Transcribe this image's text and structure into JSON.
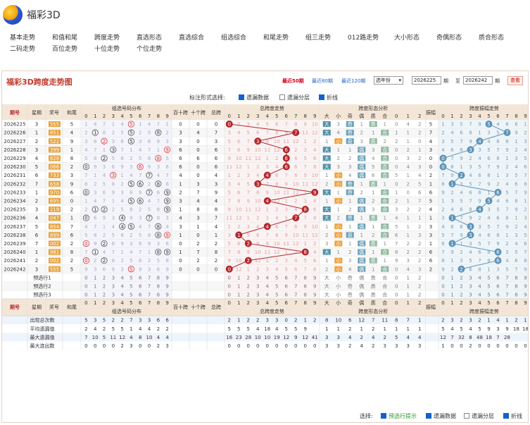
{
  "app": {
    "title": "福彩3D"
  },
  "nav": [
    "基本走势",
    "和值和尾",
    "跨度走势",
    "直选形态",
    "直选综合",
    "组选综合",
    "和尾走势",
    "组三走势",
    "012路走势",
    "大小形态",
    "奇偶形态",
    "质合形态",
    "二码走势",
    "百位走势",
    "十位走势",
    "个位走势"
  ],
  "panel": {
    "title": "福彩3D跨度走势图",
    "links": [
      "最近50期",
      "最近80期",
      "最近120期"
    ],
    "year_select": "选年份",
    "from_issue": "2026225",
    "to_sep": "至",
    "to_issue": "2026242",
    "issue_unit": "期",
    "query_button": "查看"
  },
  "display_options": {
    "label": "标注形式选择:",
    "items": [
      {
        "label": "遗漏数据",
        "checked": true
      },
      {
        "label": "遗漏分层",
        "checked": false
      },
      {
        "label": "折线",
        "checked": true
      }
    ]
  },
  "columns": {
    "issue": "期号",
    "week": "星期",
    "prize": "奖号",
    "sum": "和尾",
    "group_dist": "组选号码分布",
    "hundreds_ten_span": "百十跨",
    "tens_unit_span": "十个跨",
    "total_span": "总跨",
    "span_trend": "总跨度走势",
    "span_form": "跨度形态分析",
    "form_heads": [
      "大",
      "小",
      "奇",
      "偶",
      "质",
      "合",
      "0",
      "1",
      "2"
    ],
    "amplitude": "振幅",
    "amp_trend": "跨度振幅走势",
    "digits": [
      "0",
      "1",
      "2",
      "3",
      "4",
      "5",
      "6",
      "7",
      "8",
      "9"
    ]
  },
  "rows": [
    {
      "issue": "2026225",
      "week": "3",
      "prize": "555",
      "sum": "5",
      "hs": "0",
      "tu": "0",
      "span": "0",
      "form": [
        "大",
        "3",
        "奇",
        "1",
        "质",
        "1",
        "0",
        "4",
        "2"
      ],
      "amp": "5"
    },
    {
      "issue": "2026226",
      "week": "1",
      "prize": "851",
      "sum": "4",
      "hs": "3",
      "tu": "4",
      "span": "7",
      "form": [
        "大",
        "4",
        "奇",
        "2",
        "1",
        "合",
        "1",
        "1",
        "2"
      ],
      "amp": "7"
    },
    {
      "issue": "2026227",
      "week": "2",
      "prize": "522",
      "sum": "9",
      "hs": "3",
      "tu": "0",
      "span": "3",
      "form": [
        "1",
        "小",
        "奇",
        "3",
        "质",
        "2",
        "2",
        "1",
        "0"
      ],
      "amp": "4"
    },
    {
      "issue": "2026228",
      "week": "3",
      "prize": "399",
      "sum": "1",
      "hs": "6",
      "tu": "0",
      "span": "6",
      "form": [
        "大",
        "1",
        "1",
        "偶",
        "3",
        "合",
        "0",
        "2",
        "1"
      ],
      "amp": "3"
    },
    {
      "issue": "2026229",
      "week": "4",
      "prize": "828",
      "sum": "8",
      "hs": "6",
      "tu": "6",
      "span": "6",
      "form": [
        "大",
        "2",
        "2",
        "偶",
        "4",
        "合",
        "0",
        "3",
        "2"
      ],
      "amp": "0"
    },
    {
      "issue": "2026230",
      "week": "5",
      "prize": "066",
      "sum": "2",
      "hs": "6",
      "tu": "0",
      "span": "6",
      "form": [
        "大",
        "3",
        "3",
        "偶",
        "5",
        "合",
        "0",
        "4",
        "3"
      ],
      "amp": "0"
    },
    {
      "issue": "2026231",
      "week": "6",
      "prize": "733",
      "sum": "3",
      "hs": "4",
      "tu": "0",
      "span": "4",
      "form": [
        "1",
        "小",
        "4",
        "偶",
        "6",
        "合",
        "5",
        "1",
        "4"
      ],
      "amp": "2"
    },
    {
      "issue": "2026232",
      "week": "7",
      "prize": "658",
      "sum": "9",
      "hs": "1",
      "tu": "3",
      "span": "3",
      "form": [
        "2",
        "小",
        "奇",
        "1",
        "质",
        "1",
        "0",
        "2",
        "5"
      ],
      "amp": "1"
    },
    {
      "issue": "2026233",
      "week": "1",
      "prize": "970",
      "sum": "6",
      "hs": "2",
      "tu": "7",
      "span": "9",
      "form": [
        "大",
        "1",
        "奇",
        "2",
        "1",
        "合",
        "1",
        "0",
        "6"
      ],
      "amp": "6"
    },
    {
      "issue": "2026234",
      "week": "2",
      "prize": "695",
      "sum": "0",
      "hs": "3",
      "tu": "4",
      "span": "4",
      "form": [
        "1",
        "小",
        "1",
        "偶",
        "2",
        "合",
        "2",
        "1",
        "7"
      ],
      "amp": "5"
    },
    {
      "issue": "2026235",
      "week": "3",
      "prize": "219",
      "sum": "2",
      "hs": "1",
      "tu": "8",
      "span": "8",
      "form": [
        "大",
        "1",
        "2",
        "偶",
        "3",
        "合",
        "3",
        "2",
        "2"
      ],
      "amp": "4"
    },
    {
      "issue": "2026236",
      "week": "4",
      "prize": "047",
      "sum": "1",
      "hs": "4",
      "tu": "3",
      "span": "7",
      "form": [
        "大",
        "2",
        "奇",
        "1",
        "质",
        "1",
        "4",
        "1",
        "1"
      ],
      "amp": "1"
    },
    {
      "issue": "2026237",
      "week": "5",
      "prize": "854",
      "sum": "7",
      "hs": "3",
      "tu": "1",
      "span": "4",
      "form": [
        "1",
        "小",
        "1",
        "偶",
        "1",
        "合",
        "5",
        "1",
        "2"
      ],
      "amp": "3"
    },
    {
      "issue": "2026238",
      "week": "6",
      "prize": "899",
      "sum": "6",
      "hs": "1",
      "tu": "0",
      "span": "1",
      "form": [
        "2",
        "小",
        "奇",
        "1",
        "2",
        "合",
        "6",
        "1",
        "3"
      ],
      "amp": "3"
    },
    {
      "issue": "2026239",
      "week": "7",
      "prize": "002",
      "sum": "2",
      "hs": "0",
      "tu": "2",
      "span": "2",
      "form": [
        "3",
        "小",
        "1",
        "偶",
        "质",
        "1",
        "7",
        "2",
        "2"
      ],
      "amp": "1"
    },
    {
      "issue": "2026240",
      "week": "1",
      "prize": "981",
      "sum": "8",
      "hs": "1",
      "tu": "7",
      "span": "8",
      "form": [
        "大",
        "1",
        "2",
        "偶",
        "1",
        "合",
        "8",
        "2",
        "2"
      ],
      "amp": "6"
    },
    {
      "issue": "2026241",
      "week": "2",
      "prize": "002",
      "sum": "2",
      "hs": "0",
      "tu": "2",
      "span": "2",
      "form": [
        "1",
        "小",
        "3",
        "偶",
        "质",
        "1",
        "9",
        "3",
        "2"
      ],
      "amp": "6"
    },
    {
      "issue": "2026242",
      "week": "3",
      "prize": "555",
      "sum": "5",
      "hs": "0",
      "tu": "0",
      "span": "0",
      "form": [
        "2",
        "小",
        "4",
        "偶",
        "1",
        "合",
        "0",
        "4",
        "3"
      ],
      "amp": "2"
    }
  ],
  "predict_rows": [
    "预选行1",
    "预选行2",
    "预选行3"
  ],
  "footer_head": {
    "prize": "奖号"
  },
  "stats": [
    {
      "label": "出现总次数",
      "dist": [
        "5",
        "3",
        "5",
        "2",
        "2",
        "7",
        "3",
        "3",
        "6",
        "6"
      ],
      "span": [
        "2",
        "1",
        "2",
        "2",
        "3",
        "3",
        "0",
        "2",
        "1",
        "2"
      ],
      "form": [
        "8",
        "10",
        "6",
        "12",
        "7",
        "11",
        "8",
        "7",
        "1"
      ],
      "amp": [
        "2",
        "3",
        "2",
        "3",
        "2",
        "1",
        "4",
        "1",
        "2",
        "1"
      ]
    },
    {
      "label": "平均遗漏值",
      "dist": [
        "2",
        "4",
        "2",
        "5",
        "5",
        "1",
        "4",
        "4",
        "2",
        "2"
      ],
      "span": [
        "5",
        "5",
        "5",
        "4",
        "18",
        "4",
        "5",
        "5",
        "9"
      ],
      "form": [
        "1",
        "1",
        "2",
        "1",
        "2",
        "1",
        "1",
        "1",
        "1"
      ],
      "amp": [
        "5",
        "4",
        "5",
        "4",
        "5",
        "9",
        "3",
        "9",
        "18",
        "18"
      ]
    },
    {
      "label": "最大遗漏值",
      "dist": [
        "7",
        "10",
        "5",
        "11",
        "12",
        "4",
        "8",
        "10",
        "4",
        "4"
      ],
      "span": [
        "16",
        "23",
        "28",
        "10",
        "10",
        "19",
        "12",
        "9",
        "12",
        "41"
      ],
      "form": [
        "3",
        "3",
        "4",
        "2",
        "4",
        "2",
        "5",
        "4",
        "4"
      ],
      "amp": [
        "12",
        "7",
        "32",
        "8",
        "48",
        "18",
        "7",
        "28"
      ]
    },
    {
      "label": "最大连出数",
      "dist": [
        "0",
        "0",
        "0",
        "0",
        "2",
        "3",
        "0",
        "0",
        "2",
        "3"
      ],
      "span": [
        "0",
        "0",
        "0",
        "0",
        "0",
        "0",
        "0",
        "0",
        "0",
        "0"
      ],
      "form": [
        "3",
        "3",
        "2",
        "4",
        "2",
        "3",
        "3",
        "3",
        "3"
      ],
      "amp": [
        "1",
        "0",
        "0",
        "2",
        "0",
        "0",
        "0",
        "0",
        "0",
        "0"
      ]
    }
  ],
  "bottom": {
    "label": "选择:",
    "items": [
      {
        "label": "预选行提示",
        "checked": true
      },
      {
        "label": "遗漏数据",
        "checked": true
      },
      {
        "label": "遗漏分层",
        "checked": false
      },
      {
        "label": "折线",
        "checked": true
      }
    ]
  },
  "colors": {
    "accent": "#c0392b",
    "ball": "#b5262c",
    "line": "#b5262c",
    "amp_ball": "#5e93b8",
    "prize_bg": "#e8a23c",
    "big": "#4f8fa8",
    "small": "#f0a23a",
    "head_bg": "#f4e6d6"
  }
}
